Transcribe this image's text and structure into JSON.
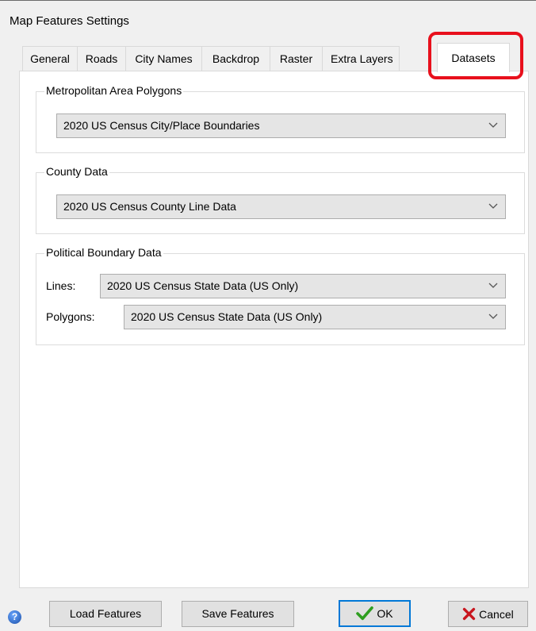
{
  "window": {
    "title": "Map Features Settings"
  },
  "tabs": [
    {
      "label": "General"
    },
    {
      "label": "Roads"
    },
    {
      "label": "City Names"
    },
    {
      "label": "Backdrop"
    },
    {
      "label": "Raster"
    },
    {
      "label": "Extra Layers"
    },
    {
      "label": "Datasets",
      "active": true
    }
  ],
  "groups": {
    "metro": {
      "title": "Metropolitan Area Polygons",
      "selected": "2020 US Census City/Place Boundaries"
    },
    "county": {
      "title": "County Data",
      "selected": "2020 US Census County Line Data"
    },
    "political": {
      "title": "Political Boundary Data",
      "lines_label": "Lines:",
      "lines_selected": "2020 US Census State Data (US Only)",
      "polygons_label": "Polygons:",
      "polygons_selected": "2020 US Census State Data (US Only)"
    }
  },
  "buttons": {
    "load": "Load Features",
    "save": "Save Features",
    "ok": "OK",
    "cancel": "Cancel"
  },
  "colors": {
    "highlight": "#e8101c",
    "ok_check": "#2e9e1f",
    "cancel_x": "#c8161e",
    "default_button_border": "#0078d7"
  },
  "icons": {
    "help": "help-icon",
    "ok": "checkmark-icon",
    "cancel": "x-icon",
    "dropdown": "chevron-down-icon"
  }
}
